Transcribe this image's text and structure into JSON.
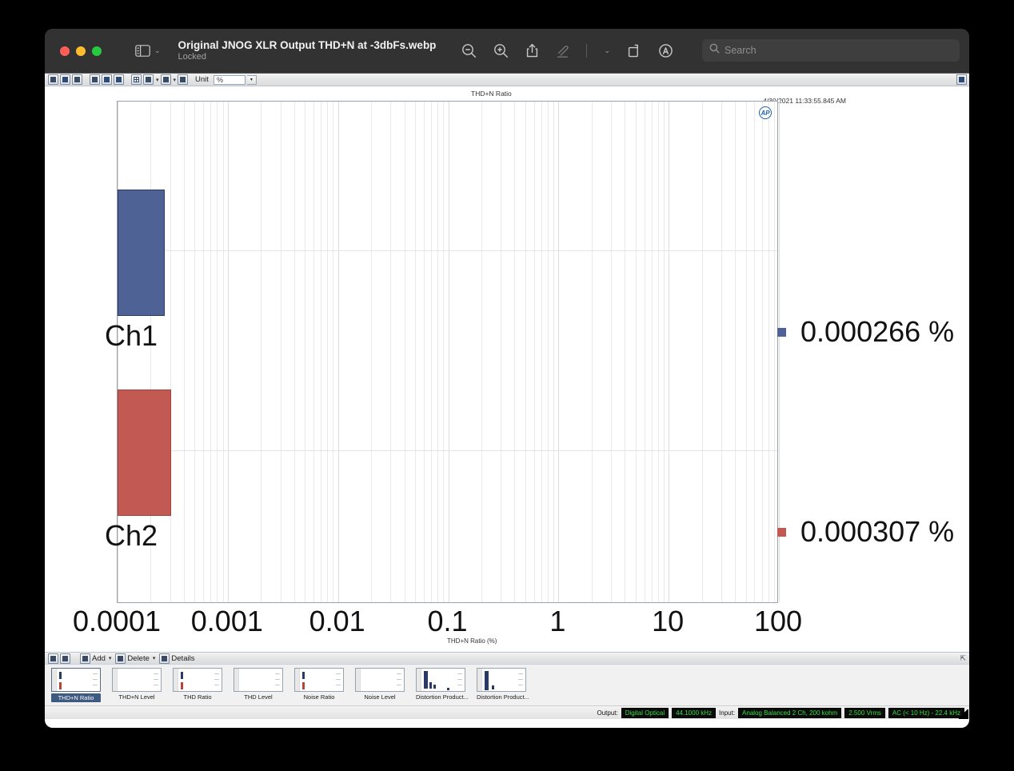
{
  "window": {
    "title": "Original JNOG XLR Output THD+N at -3dbFs.webp",
    "subtitle": "Locked",
    "traffic": {
      "close": "close-button",
      "minimize": "minimize-button",
      "zoom": "zoom-button"
    }
  },
  "toolbar": {
    "sidebar_toggle": "sidebar-toggle",
    "zoom_out": "zoom-out-icon",
    "zoom_in": "zoom-in-icon",
    "share": "share-icon",
    "markup": "markup-pen-icon",
    "markup_caret": "⌄",
    "rotate": "rotate-icon",
    "annotate": "annotate-icon",
    "search_placeholder": "Search",
    "search_icon": "search-icon"
  },
  "ap_toolbar": {
    "icons": [
      "save-icon",
      "export-icon",
      "print-icon",
      "zoom-tool-icon",
      "pan-tool-icon",
      "fit-tool-icon",
      "table-view-icon",
      "axis-settings-icon",
      "curve-settings-icon",
      "gear-icon"
    ],
    "unit_label": "Unit",
    "unit_value": "%",
    "expand_icon": "expand-panel-icon"
  },
  "graph": {
    "title": "THD+N Ratio",
    "timestamp": "4/30/2021 11:33:55.845 AM",
    "logo": "AP",
    "logo_name": "audio-precision-logo"
  },
  "chart_data": {
    "type": "bar",
    "orientation": "horizontal",
    "title": "THD+N Ratio",
    "xlabel": "THD+N Ratio (%)",
    "ylabel": "",
    "xscale": "log",
    "xlim": [
      0.0001,
      100
    ],
    "xticks": [
      "0.0001",
      "0.001",
      "0.01",
      "0.1",
      "1",
      "10",
      "100"
    ],
    "xtick_values": [
      0.0001,
      0.001,
      0.01,
      0.1,
      1,
      100
    ],
    "grid": true,
    "legend": "right-readout",
    "categories": [
      "Ch1",
      "Ch2"
    ],
    "values": [
      0.000266,
      0.000307
    ],
    "units": "%",
    "series": [
      {
        "name": "Ch1",
        "value": 0.000266,
        "display": "0.000266 %",
        "color": "#4f6295"
      },
      {
        "name": "Ch2",
        "value": 0.000307,
        "display": "0.000307 %",
        "color": "#c25a53"
      }
    ]
  },
  "bottom_toolbar": {
    "first_button": "first-item-icon",
    "last_button": "last-item-icon",
    "add_label": "Add",
    "delete_label": "Delete",
    "details_label": "Details",
    "caret": "▾"
  },
  "thumbnails": [
    {
      "label": "THD+N Ratio",
      "selected": true
    },
    {
      "label": "THD+N Level",
      "selected": false
    },
    {
      "label": "THD Ratio",
      "selected": false
    },
    {
      "label": "THD Level",
      "selected": false
    },
    {
      "label": "Noise Ratio",
      "selected": false
    },
    {
      "label": "Noise Level",
      "selected": false
    },
    {
      "label": "Distortion  Product...",
      "selected": false
    },
    {
      "label": "Distortion  Product...",
      "selected": false
    }
  ],
  "status": {
    "output_label": "Output:",
    "output_value": "Digital Optical",
    "output_rate": "44.1000 kHz",
    "input_label": "Input:",
    "input_value": "Analog Balanced 2 Ch, 200 kohm",
    "input_level": "2.500 Vrms",
    "input_bw": "AC (< 10 Hz) - 22.4 kHz"
  },
  "colors": {
    "ch1": "#4f6295",
    "ch2": "#c25a53",
    "status_text": "#3ddc4a"
  }
}
